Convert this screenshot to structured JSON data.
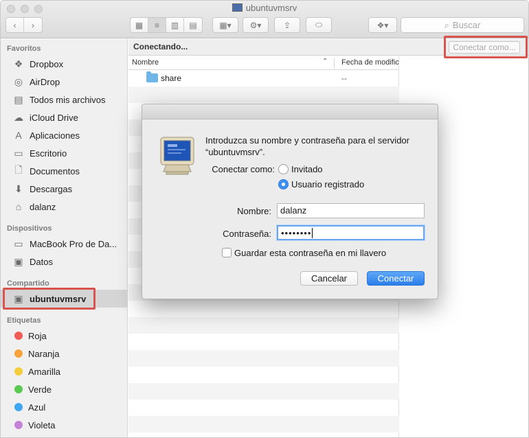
{
  "window": {
    "title": "ubuntuvmsrv"
  },
  "toolbar": {
    "search_placeholder": "Buscar"
  },
  "sidebar": {
    "sections": {
      "favorites": "Favoritos",
      "devices": "Dispositivos",
      "shared": "Compartido",
      "tags": "Etiquetas"
    },
    "favorites": [
      {
        "label": "Dropbox",
        "icon": "dropbox-icon"
      },
      {
        "label": "AirDrop",
        "icon": "airdrop-icon"
      },
      {
        "label": "Todos mis archivos",
        "icon": "all-files-icon"
      },
      {
        "label": "iCloud Drive",
        "icon": "cloud-icon"
      },
      {
        "label": "Aplicaciones",
        "icon": "applications-icon"
      },
      {
        "label": "Escritorio",
        "icon": "desktop-icon"
      },
      {
        "label": "Documentos",
        "icon": "documents-icon"
      },
      {
        "label": "Descargas",
        "icon": "downloads-icon"
      },
      {
        "label": "dalanz",
        "icon": "home-icon"
      }
    ],
    "devices": [
      {
        "label": "MacBook Pro de Da...",
        "icon": "laptop-icon"
      },
      {
        "label": "Datos",
        "icon": "disk-icon"
      }
    ],
    "shared": [
      {
        "label": "ubuntuvmsrv",
        "icon": "server-icon"
      }
    ],
    "tags": [
      {
        "label": "Roja",
        "color": "#f25b55"
      },
      {
        "label": "Naranja",
        "color": "#f7a23c"
      },
      {
        "label": "Amarilla",
        "color": "#f5cd3b"
      },
      {
        "label": "Verde",
        "color": "#5bc950"
      },
      {
        "label": "Azul",
        "color": "#3ea7f2"
      },
      {
        "label": "Violeta",
        "color": "#c583d8"
      }
    ]
  },
  "pathbar": {
    "status": "Conectando...",
    "connect_as_button": "Conectar como..."
  },
  "filelist": {
    "columns": {
      "name": "Nombre",
      "date": "Fecha de modificación"
    },
    "rows": [
      {
        "name": "share",
        "date": "--"
      }
    ]
  },
  "dialog": {
    "message": "Introduzca su nombre y contraseña para el servidor “ubuntuvmsrv”.",
    "connect_as_label": "Conectar como:",
    "option_guest": "Invitado",
    "option_registered": "Usuario registrado",
    "selected_option": "registered",
    "name_label": "Nombre:",
    "name_value": "dalanz",
    "password_label": "Contraseña:",
    "password_masked": "••••••••",
    "remember_label": "Guardar esta contraseña en mi llavero",
    "remember_checked": false,
    "cancel_button": "Cancelar",
    "connect_button": "Conectar"
  },
  "colors": {
    "accent": "#3f8ff0",
    "highlight_box": "#d9534f"
  }
}
